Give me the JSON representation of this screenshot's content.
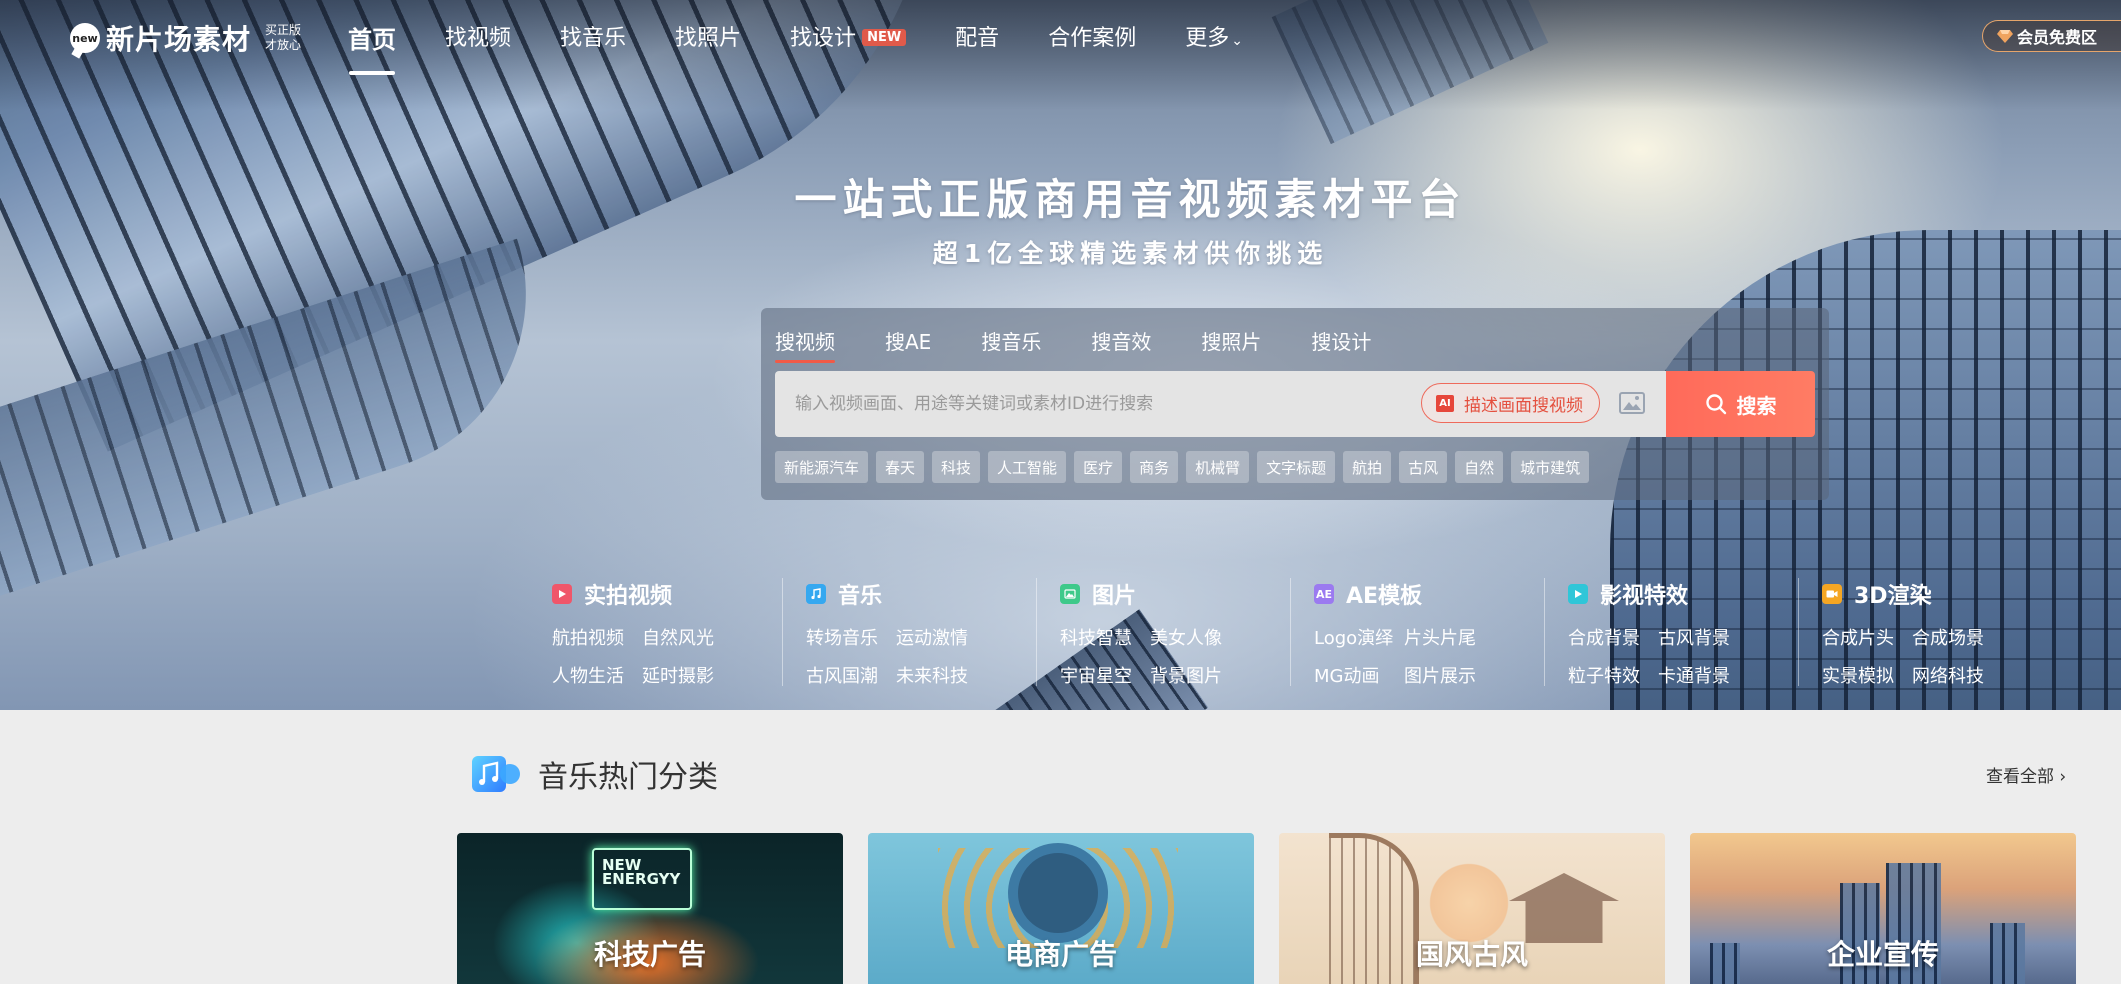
{
  "nav": {
    "logo_badge": "new",
    "logo_text": "新片场素材",
    "logo_slogan_1": "买正版",
    "logo_slogan_2": "才放心",
    "links": [
      "首页",
      "找视频",
      "找音乐",
      "找照片",
      "找设计",
      "配音",
      "合作案例",
      "更多"
    ],
    "new_badge": "NEW",
    "more_arrow": "⌄",
    "vip_label": "会员免费区"
  },
  "hero": {
    "headline": "一站式正版商用音视频素材平台",
    "subline": "超1亿全球精选素材供你挑选"
  },
  "search": {
    "tabs": [
      "搜视频",
      "搜AE",
      "搜音乐",
      "搜音效",
      "搜照片",
      "搜设计"
    ],
    "placeholder": "输入视频画面、用途等关键词或素材ID进行搜索",
    "ai_badge": "AI",
    "ai_label": "描述画面搜视频",
    "button_label": "搜索",
    "hot_tags": [
      "新能源汽车",
      "春天",
      "科技",
      "人工智能",
      "医疗",
      "商务",
      "机械臂",
      "文字标题",
      "航拍",
      "古风",
      "自然",
      "城市建筑"
    ]
  },
  "categories": [
    {
      "title": "实拍视频",
      "icon": "video-icon",
      "color": "#f0566a",
      "links": [
        "航拍视频",
        "自然风光",
        "人物生活",
        "延时摄影"
      ]
    },
    {
      "title": "音乐",
      "icon": "music-note-icon",
      "color": "#35a8f0",
      "links": [
        "转场音乐",
        "运动激情",
        "古风国潮",
        "未来科技"
      ]
    },
    {
      "title": "图片",
      "icon": "image-icon",
      "color": "#3ec98a",
      "links": [
        "科技智慧",
        "美女人像",
        "宇宙星空",
        "背景图片"
      ]
    },
    {
      "title": "AE模板",
      "icon": "ae-icon",
      "icon_text": "AE",
      "color": "#9b7af0",
      "links": [
        "Logo演绎",
        "片头片尾",
        "MG动画",
        "图片展示"
      ]
    },
    {
      "title": "影视特效",
      "icon": "play-icon",
      "color": "#2fc6d8",
      "links": [
        "合成背景",
        "古风背景",
        "粒子特效",
        "卡通背景"
      ]
    },
    {
      "title": "3D渲染",
      "icon": "camera-icon",
      "color": "#f5a623",
      "links": [
        "合成片头",
        "合成场景",
        "实景模拟",
        "网络科技"
      ]
    }
  ],
  "music_section": {
    "title": "音乐热门分类",
    "view_all": "查看全部",
    "view_all_arrow": "›",
    "cards": [
      {
        "label": "科技广告",
        "neon_text_1": "NEW",
        "neon_text_2": "ENERGYY"
      },
      {
        "label": "电商广告"
      },
      {
        "label": "国风古风"
      },
      {
        "label": "企业宣传"
      }
    ]
  },
  "colors": {
    "accent": "#ff6a5a",
    "vip_border": "#e6a56b"
  }
}
